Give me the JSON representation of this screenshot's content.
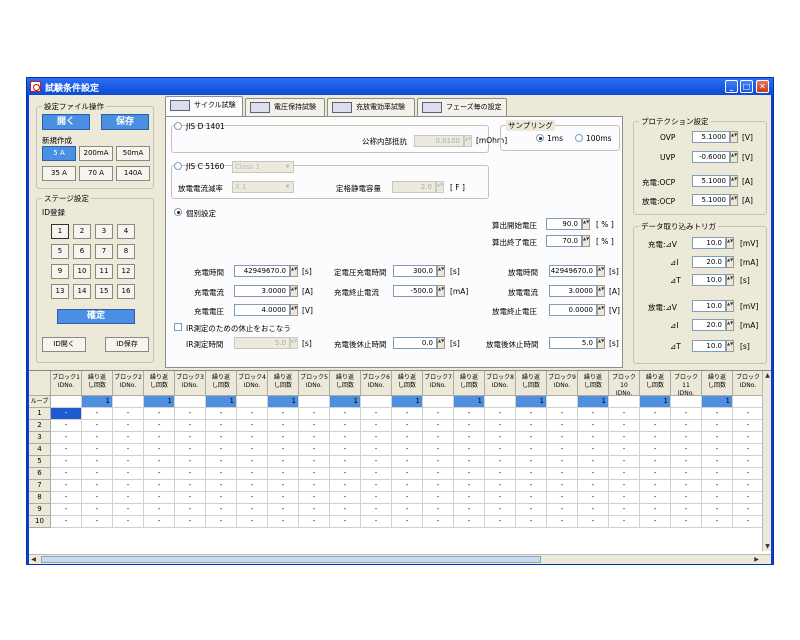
{
  "window": {
    "title": "試験条件設定"
  },
  "settings_file": {
    "label": "設定ファイル操作",
    "open": "開く",
    "save": "保存"
  },
  "new_creation": {
    "label": "新規作成",
    "buttons": [
      "5 A",
      "200mA",
      "50mA",
      "35 A",
      "70 A",
      "140A"
    ]
  },
  "stage": {
    "label": "ステージ設定",
    "id_label": "ID登録",
    "ids": [
      "1",
      "2",
      "3",
      "4",
      "5",
      "6",
      "7",
      "8",
      "9",
      "10",
      "11",
      "12",
      "13",
      "14",
      "15",
      "16"
    ],
    "confirm": "確定",
    "id_open": "ID開く",
    "id_save": "ID保存"
  },
  "tabs": [
    "サイクル試験",
    "電圧保持試験",
    "充放電効率試験",
    "フェーズ毎の設定"
  ],
  "cycle": {
    "jis1401": "JIS D 1401",
    "internal_res_label": "公称内部抵抗",
    "internal_res_value": "0.0100",
    "internal_res_unit": "[mOhm]",
    "sampling_label": "サンプリング",
    "sampling_1ms": "1ms",
    "sampling_100ms": "100ms",
    "jis5160": "JIS C 5160",
    "class_value": "Class 1",
    "discharge_rate_label": "放電電流減率",
    "discharge_rate_value": "X  1",
    "rated_cap_label": "定格静電容量",
    "rated_cap_value": "2.0",
    "rated_cap_unit": "[ F ]",
    "individual": "個別設定",
    "calc_start_v_label": "算出開始電圧",
    "calc_start_v_value": "90.0",
    "calc_start_v_unit": "[ % ]",
    "calc_end_v_label": "算出終了電圧",
    "calc_end_v_value": "70.0",
    "calc_end_v_unit": "[ % ]",
    "charge_time_label": "充電時間",
    "charge_time_value": "42949670.0",
    "charge_time_unit": "[s]",
    "cv_charge_time_label": "定電圧充電時間",
    "cv_charge_time_value": "300.0",
    "cv_charge_time_unit": "[s]",
    "discharge_time_label": "放電時間",
    "discharge_time_value": "42949670.0",
    "discharge_time_unit": "[s]",
    "charge_current_label": "充電電流",
    "charge_current_value": "3.0000",
    "charge_current_unit": "[A]",
    "charge_end_current_label": "充電終止電流",
    "charge_end_current_value": "-500.0",
    "charge_end_current_unit": "[mA]",
    "discharge_current_label": "放電電流",
    "discharge_current_value": "3.0000",
    "discharge_current_unit": "[A]",
    "charge_voltage_label": "充電電圧",
    "charge_voltage_value": "4.0000",
    "charge_voltage_unit": "[V]",
    "discharge_end_v_label": "放電終止電圧",
    "discharge_end_v_value": "0.0000",
    "discharge_end_v_unit": "[V]",
    "ir_pause_label": "IR測定のための休止をおこなう",
    "ir_time_label": "IR測定時間",
    "ir_time_value": "5.0",
    "ir_time_unit": "[s]",
    "after_charge_pause_label": "充電後休止時間",
    "after_charge_pause_value": "0.0",
    "after_charge_pause_unit": "[s]",
    "after_discharge_pause_label": "放電後休止時間",
    "after_discharge_pause_value": "5.0",
    "after_discharge_pause_unit": "[s]"
  },
  "protection": {
    "label": "プロテクション設定",
    "ovp_label": "OVP",
    "ovp_value": "5.1000",
    "ovp_unit": "[V]",
    "uvp_label": "UVP",
    "uvp_value": "-0.6000",
    "uvp_unit": "[V]",
    "chg_ocp_label": "充電:OCP",
    "chg_ocp_value": "5.1000",
    "chg_ocp_unit": "[A]",
    "dis_ocp_label": "放電:OCP",
    "dis_ocp_value": "5.1000",
    "dis_ocp_unit": "[A]"
  },
  "trigger": {
    "label": "データ取り込みトリガ",
    "c_dv_label": "充電:⊿V",
    "c_dv_value": "10.0",
    "c_dv_unit": "[mV]",
    "c_di_label": "⊿I",
    "c_di_value": "20.0",
    "c_di_unit": "[mA]",
    "c_dt_label": "⊿T",
    "c_dt_value": "10.0",
    "c_dt_unit": "[s]",
    "d_dv_label": "放電:⊿V",
    "d_dv_value": "10.0",
    "d_dv_unit": "[mV]",
    "d_di_label": "⊿I",
    "d_di_value": "20.0",
    "d_di_unit": "[mA]",
    "d_dt_label": "⊿T",
    "d_dt_value": "10.0",
    "d_dt_unit": "[s]"
  },
  "grid": {
    "headers": [
      [
        "ブロック1",
        "IDNo."
      ],
      [
        "繰り返",
        "し回数"
      ],
      [
        "ブロック2",
        "IDNo."
      ],
      [
        "繰り返",
        "し回数"
      ],
      [
        "ブロック3",
        "IDNo."
      ],
      [
        "繰り返",
        "し回数"
      ],
      [
        "ブロック4",
        "IDNo."
      ],
      [
        "繰り返",
        "し回数"
      ],
      [
        "ブロック5",
        "IDNo."
      ],
      [
        "繰り返",
        "し回数"
      ],
      [
        "ブロック6",
        "IDNo."
      ],
      [
        "繰り返",
        "し回数"
      ],
      [
        "ブロック7",
        "IDNo."
      ],
      [
        "繰り返",
        "し回数"
      ],
      [
        "ブロック8",
        "IDNo."
      ],
      [
        "繰り返",
        "し回数"
      ],
      [
        "ブロック9",
        "IDNo."
      ],
      [
        "繰り返",
        "し回数"
      ],
      [
        "ブロック10",
        "IDNo."
      ],
      [
        "繰り返",
        "し回数"
      ],
      [
        "ブロック11",
        "IDNo."
      ],
      [
        "繰り返",
        "し回数"
      ],
      [
        "ブロック",
        "IDNo."
      ]
    ],
    "loop_label": "ループ",
    "loop_values": [
      "",
      "1",
      "",
      "1",
      "",
      "1",
      "",
      "1",
      "",
      "1",
      "",
      "1",
      "",
      "1",
      "",
      "1",
      "",
      "1",
      "",
      "1",
      "",
      "1",
      ""
    ],
    "rows": [
      "1",
      "2",
      "3",
      "4",
      "5",
      "6",
      "7",
      "8",
      "9",
      "10"
    ],
    "cell": "-"
  }
}
